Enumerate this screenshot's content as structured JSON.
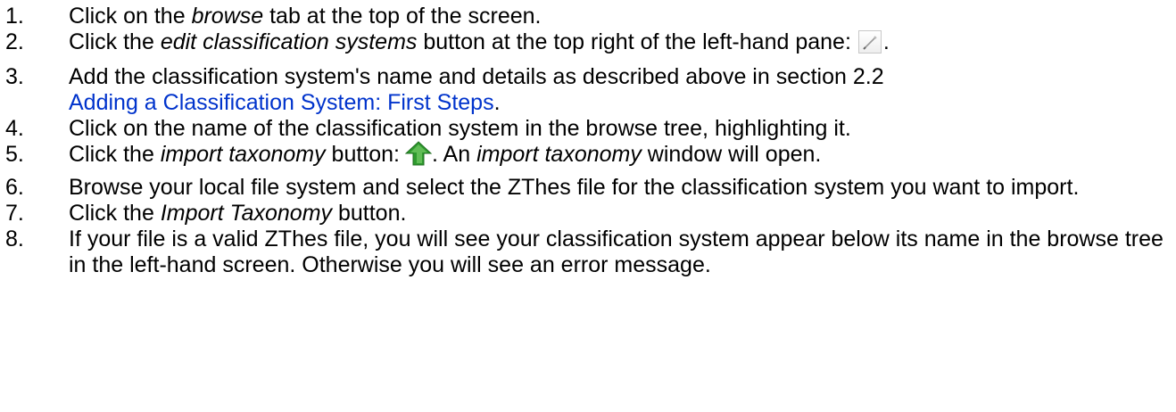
{
  "steps": [
    {
      "num": "1.",
      "a": "Click on the ",
      "b": "browse",
      "c": " tab at the top of the screen."
    },
    {
      "num": "2.",
      "a": "Click the ",
      "b": "edit classification systems",
      "c": " button at the top right of the left-hand pane:",
      "d": ".",
      "icon": "edit-icon"
    },
    {
      "num": "3.",
      "a": "Add the classification system's name and details as described above in section 2.2",
      "link": "Adding a Classification System: First Steps",
      "d": "."
    },
    {
      "num": "4.",
      "a": "Click on the name of the classification system in the browse tree, highlighting it."
    },
    {
      "num": "5.",
      "a": "Click the ",
      "b": "import taxonomy",
      "c": " button:",
      "d": ". An ",
      "e": "import taxonomy",
      "f": " window will open.",
      "icon": "import-arrow-icon",
      "icon_color": "#2e9a2e"
    },
    {
      "num": "6.",
      "a": "Browse your local file system and select the ZThes file for the classification system you want to import."
    },
    {
      "num": "7.",
      "a": "Click the ",
      "b": "Import Taxonomy",
      "c": " button."
    },
    {
      "num": "8.",
      "a": "If your file is a valid ZThes file, you will see your classification system appear below its name in the browse tree in the left-hand screen. Otherwise you will see an error message."
    }
  ],
  "colors": {
    "text": "#000000",
    "link": "#0033cc",
    "background": "#ffffff"
  }
}
